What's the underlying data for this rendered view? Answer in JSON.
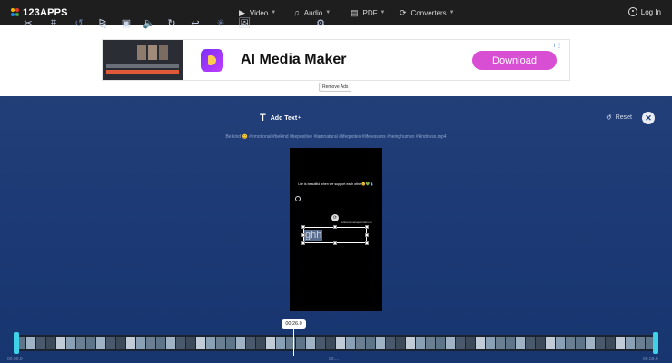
{
  "brand": {
    "logo_text": "123APPS",
    "dot_colors": [
      "#f5b400",
      "#e53935",
      "#1e88e5",
      "#43a047"
    ]
  },
  "nav": {
    "items": [
      {
        "label": "Video",
        "icon": "play-box-icon"
      },
      {
        "label": "Audio",
        "icon": "music-note-icon"
      },
      {
        "label": "PDF",
        "icon": "document-icon"
      },
      {
        "label": "Converters",
        "icon": "refresh-icon"
      }
    ],
    "login_label": "Log In"
  },
  "ad": {
    "title": "AI Media Maker",
    "button_label": "Download",
    "remove_ads_label": "Remove Ads",
    "info": "i ⋮"
  },
  "toolbar": {
    "tools": [
      {
        "name": "cut-tool",
        "glyph": "✂",
        "enabled": true
      },
      {
        "name": "crop-tool",
        "glyph": "⌗",
        "enabled": true
      },
      {
        "name": "undo-tool",
        "glyph": "↺",
        "enabled": false
      },
      {
        "name": "flip-tool",
        "glyph": "⧎",
        "enabled": true
      },
      {
        "name": "resize-tool",
        "glyph": "▣",
        "enabled": true
      },
      {
        "name": "volume-tool",
        "glyph": "🔈",
        "enabled": true
      },
      {
        "name": "speed-tool",
        "glyph": "↻",
        "enabled": true
      },
      {
        "name": "loop-tool",
        "glyph": "↩",
        "enabled": true
      },
      {
        "name": "stabilize-tool",
        "glyph": "✳",
        "enabled": false
      },
      {
        "name": "image-tool",
        "glyph": "🖼",
        "enabled": true
      },
      {
        "name": "text-tool",
        "glyph": "T",
        "enabled": true
      },
      {
        "name": "record-tool",
        "glyph": "⚙",
        "enabled": true
      }
    ],
    "add_text_label": "Add Text",
    "add_text_badge": "+",
    "reset_label": "Reset"
  },
  "file": {
    "name": "Be kind 😊 #emotional #bekind #bepositive #lamnatural #lifequotes #lifelessons #beinghuman #kindness.mp4"
  },
  "preview": {
    "caption": "Life is beautiful when we support each other😊💚💧",
    "small_text": "cultureofmanapoorvam.co",
    "overlay_text": "ghh"
  },
  "timeline": {
    "current_time": "00:26.0",
    "start_label": "00:00.0",
    "mid_label": "00:...",
    "end_label": "00:59.0"
  }
}
